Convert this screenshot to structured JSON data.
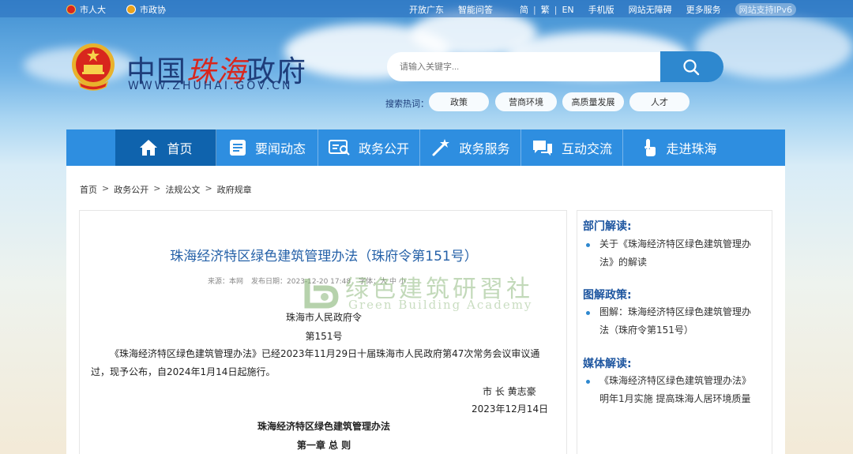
{
  "topbar": {
    "links_left": [
      "市人大",
      "市政协"
    ],
    "links_right": [
      "开放广东",
      "智能问答"
    ],
    "lang": [
      "简",
      "繁",
      "EN"
    ],
    "extra": [
      "手机版",
      "网站无障碍",
      "更多服务"
    ],
    "ipv6": "网站支持IPv6"
  },
  "header": {
    "site_name_a": "中国",
    "site_name_b": "珠海",
    "site_name_c": "政府",
    "site_url": "WWW.ZHUHAI.GOV.CN"
  },
  "search": {
    "placeholder": "请输入关键字...",
    "hot_label": "搜索热词：",
    "hot_tags": [
      "政策",
      "营商环境",
      "高质量发展",
      "人才"
    ]
  },
  "nav": {
    "items": [
      "首页",
      "要闻动态",
      "政务公开",
      "政务服务",
      "互动交流",
      "走进珠海"
    ]
  },
  "breadcrumb": [
    "首页",
    "政务公开",
    "法规公文",
    "政府规章"
  ],
  "article": {
    "title": "珠海经济特区绿色建筑管理办法（珠府令第151号）",
    "meta_source": "来源：本网",
    "meta_date": "发布日期：2023-12-20 17:48",
    "meta_font": "字体：大 中 小",
    "issuer": "珠海市人民政府令",
    "order_no": "第151号",
    "body_line1": "《珠海经济特区绿色建筑管理办法》已经2023年11月29日十届珠海市人民政府第47次常务会议审议通",
    "body_line2": "过，现予公布，自2024年1月14日起施行。",
    "signer": "市 长  黄志豪",
    "sign_date": "2023年12月14日",
    "doc_title": "珠海经济特区绿色建筑管理办法",
    "chapter": "第一章  总  则"
  },
  "watermark": {
    "zh": "绿色建筑研習社",
    "en": "Green Building Academy"
  },
  "sidebar": {
    "sections": [
      {
        "heading": "部门解读:",
        "item_line1": "关于《珠海经济特区绿色建筑管理办",
        "item_line2": "法》的解读"
      },
      {
        "heading": "图解政策:",
        "item_line1": "图解：珠海经济特区绿色建筑管理办",
        "item_line2": "法（珠府令第151号）"
      },
      {
        "heading": "媒体解读:",
        "item_line1": "《珠海经济特区绿色建筑管理办法》",
        "item_line2": "明年1月实施 提高珠海人居环境质量"
      }
    ]
  },
  "colors": {
    "nav_bg": "#2e8ee0",
    "nav_active": "#0f63ad",
    "title_blue": "#2561a8",
    "sidebar_head": "#1e56a0"
  }
}
